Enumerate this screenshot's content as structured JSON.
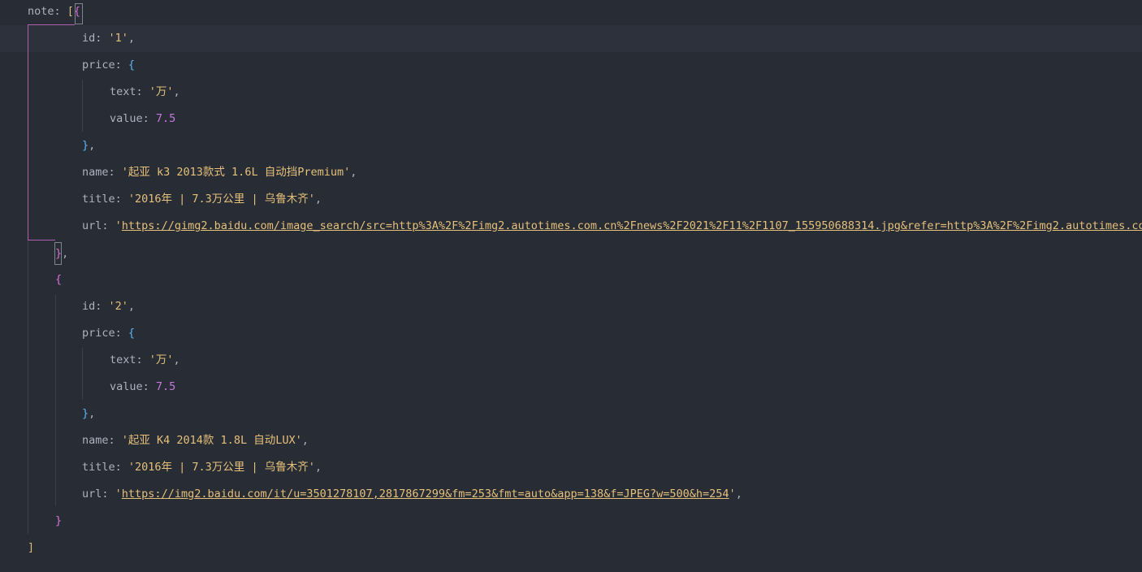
{
  "editor": {
    "lines": [
      {
        "key": "note",
        "colon": ": ",
        "open_square": "[",
        "open_brace": "{"
      },
      {
        "key": "id",
        "colon": ": ",
        "value": "'1'",
        "trail": ","
      },
      {
        "key": "price",
        "colon": ": ",
        "open": "{"
      },
      {
        "key": "text",
        "colon": ": ",
        "value": "'万'",
        "trail": ","
      },
      {
        "key": "value",
        "colon": ": ",
        "value": "7.5"
      },
      {
        "close": "}",
        "trail": ","
      },
      {
        "key": "name",
        "colon": ": ",
        "value": "'起亚 k3 2013款式 1.6L 自动挡Premium'",
        "trail": ","
      },
      {
        "key": "title",
        "colon": ": ",
        "value": "'2016年 | 7.3万公里 | 乌鲁木齐'",
        "trail": ","
      },
      {
        "key": "url",
        "colon": ": ",
        "quote_open": "'",
        "link": "https://gimg2.baidu.com/image_search/src=http%3A%2F%2Fimg2.autotimes.com.cn%2Fnews%2F2021%2F11%2F1107_155950688314.jpg&refer=http%3A%2F%2Fimg2.autotimes.com.cn&app=2002"
      },
      {
        "close": "}",
        "trail": ","
      },
      {
        "open": "{"
      },
      {
        "key": "id",
        "colon": ": ",
        "value": "'2'",
        "trail": ","
      },
      {
        "key": "price",
        "colon": ": ",
        "open": "{"
      },
      {
        "key": "text",
        "colon": ": ",
        "value": "'万'",
        "trail": ","
      },
      {
        "key": "value",
        "colon": ": ",
        "value": "7.5"
      },
      {
        "close": "}",
        "trail": ","
      },
      {
        "key": "name",
        "colon": ": ",
        "value": "'起亚 K4 2014款 1.8L 自动LUX'",
        "trail": ","
      },
      {
        "key": "title",
        "colon": ": ",
        "value": "'2016年 | 7.3万公里 | 乌鲁木齐'",
        "trail": ","
      },
      {
        "key": "url",
        "colon": ": ",
        "quote_open": "'",
        "link": "https://img2.baidu.com/it/u=3501278107,2817867299&fm=253&fmt=auto&app=138&f=JPEG?w=500&h=254",
        "quote_close": "'",
        "trail": ","
      },
      {
        "close": "}"
      },
      {
        "close": "]"
      }
    ]
  }
}
